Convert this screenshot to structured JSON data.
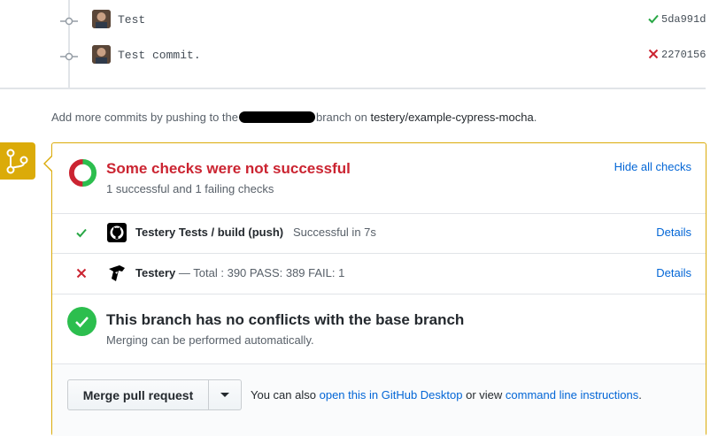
{
  "commits": [
    {
      "message": "Test",
      "status": "success",
      "sha": "5da991d",
      "status_color": "#28a745"
    },
    {
      "message": "Test commit.",
      "status": "failure",
      "sha": "2270156",
      "status_color": "#cb2431"
    }
  ],
  "push_hint": {
    "prefix": "Add more commits by pushing to the",
    "middle": "branch on",
    "repo": "testery/example-cypress-mocha",
    "suffix": "."
  },
  "checks_summary": {
    "title": "Some checks were not successful",
    "subtitle": "1 successful and 1 failing checks",
    "hide_label": "Hide all checks",
    "title_color": "#cb2431"
  },
  "checks": [
    {
      "state": "success",
      "icon": "github-icon",
      "name": "Testery Tests / build (push)",
      "description": "Successful in 7s",
      "details_label": "Details"
    },
    {
      "state": "failure",
      "icon": "testery-icon",
      "name": "Testery",
      "description": "— Total : 390 PASS: 389 FAIL: 1",
      "details_label": "Details"
    }
  ],
  "conflicts": {
    "title": "This branch has no conflicts with the base branch",
    "subtitle": "Merging can be performed automatically."
  },
  "merge": {
    "button_label": "Merge pull request",
    "hint_prefix": "You can also",
    "desktop_link": "open this in GitHub Desktop",
    "hint_middle": "or view",
    "cli_link": "command line instructions",
    "hint_suffix": "."
  },
  "colors": {
    "accent": "#0366d6",
    "warning": "#dbab09",
    "success": "#2cbe4e",
    "danger": "#cb2431"
  }
}
